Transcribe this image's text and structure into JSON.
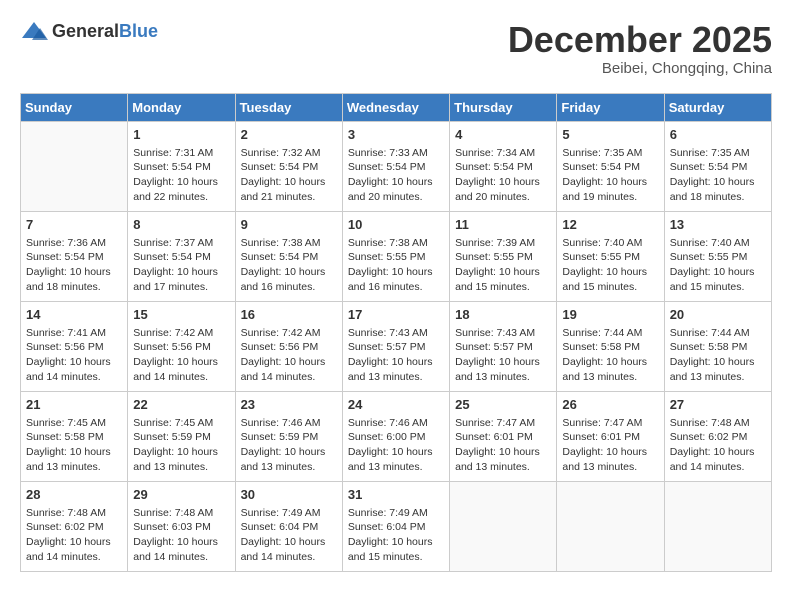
{
  "header": {
    "logo_general": "General",
    "logo_blue": "Blue",
    "month_title": "December 2025",
    "subtitle": "Beibei, Chongqing, China"
  },
  "days_of_week": [
    "Sunday",
    "Monday",
    "Tuesday",
    "Wednesday",
    "Thursday",
    "Friday",
    "Saturday"
  ],
  "weeks": [
    [
      {
        "day": "",
        "info": ""
      },
      {
        "day": "1",
        "info": "Sunrise: 7:31 AM\nSunset: 5:54 PM\nDaylight: 10 hours\nand 22 minutes."
      },
      {
        "day": "2",
        "info": "Sunrise: 7:32 AM\nSunset: 5:54 PM\nDaylight: 10 hours\nand 21 minutes."
      },
      {
        "day": "3",
        "info": "Sunrise: 7:33 AM\nSunset: 5:54 PM\nDaylight: 10 hours\nand 20 minutes."
      },
      {
        "day": "4",
        "info": "Sunrise: 7:34 AM\nSunset: 5:54 PM\nDaylight: 10 hours\nand 20 minutes."
      },
      {
        "day": "5",
        "info": "Sunrise: 7:35 AM\nSunset: 5:54 PM\nDaylight: 10 hours\nand 19 minutes."
      },
      {
        "day": "6",
        "info": "Sunrise: 7:35 AM\nSunset: 5:54 PM\nDaylight: 10 hours\nand 18 minutes."
      }
    ],
    [
      {
        "day": "7",
        "info": "Sunrise: 7:36 AM\nSunset: 5:54 PM\nDaylight: 10 hours\nand 18 minutes."
      },
      {
        "day": "8",
        "info": "Sunrise: 7:37 AM\nSunset: 5:54 PM\nDaylight: 10 hours\nand 17 minutes."
      },
      {
        "day": "9",
        "info": "Sunrise: 7:38 AM\nSunset: 5:54 PM\nDaylight: 10 hours\nand 16 minutes."
      },
      {
        "day": "10",
        "info": "Sunrise: 7:38 AM\nSunset: 5:55 PM\nDaylight: 10 hours\nand 16 minutes."
      },
      {
        "day": "11",
        "info": "Sunrise: 7:39 AM\nSunset: 5:55 PM\nDaylight: 10 hours\nand 15 minutes."
      },
      {
        "day": "12",
        "info": "Sunrise: 7:40 AM\nSunset: 5:55 PM\nDaylight: 10 hours\nand 15 minutes."
      },
      {
        "day": "13",
        "info": "Sunrise: 7:40 AM\nSunset: 5:55 PM\nDaylight: 10 hours\nand 15 minutes."
      }
    ],
    [
      {
        "day": "14",
        "info": "Sunrise: 7:41 AM\nSunset: 5:56 PM\nDaylight: 10 hours\nand 14 minutes."
      },
      {
        "day": "15",
        "info": "Sunrise: 7:42 AM\nSunset: 5:56 PM\nDaylight: 10 hours\nand 14 minutes."
      },
      {
        "day": "16",
        "info": "Sunrise: 7:42 AM\nSunset: 5:56 PM\nDaylight: 10 hours\nand 14 minutes."
      },
      {
        "day": "17",
        "info": "Sunrise: 7:43 AM\nSunset: 5:57 PM\nDaylight: 10 hours\nand 13 minutes."
      },
      {
        "day": "18",
        "info": "Sunrise: 7:43 AM\nSunset: 5:57 PM\nDaylight: 10 hours\nand 13 minutes."
      },
      {
        "day": "19",
        "info": "Sunrise: 7:44 AM\nSunset: 5:58 PM\nDaylight: 10 hours\nand 13 minutes."
      },
      {
        "day": "20",
        "info": "Sunrise: 7:44 AM\nSunset: 5:58 PM\nDaylight: 10 hours\nand 13 minutes."
      }
    ],
    [
      {
        "day": "21",
        "info": "Sunrise: 7:45 AM\nSunset: 5:58 PM\nDaylight: 10 hours\nand 13 minutes."
      },
      {
        "day": "22",
        "info": "Sunrise: 7:45 AM\nSunset: 5:59 PM\nDaylight: 10 hours\nand 13 minutes."
      },
      {
        "day": "23",
        "info": "Sunrise: 7:46 AM\nSunset: 5:59 PM\nDaylight: 10 hours\nand 13 minutes."
      },
      {
        "day": "24",
        "info": "Sunrise: 7:46 AM\nSunset: 6:00 PM\nDaylight: 10 hours\nand 13 minutes."
      },
      {
        "day": "25",
        "info": "Sunrise: 7:47 AM\nSunset: 6:01 PM\nDaylight: 10 hours\nand 13 minutes."
      },
      {
        "day": "26",
        "info": "Sunrise: 7:47 AM\nSunset: 6:01 PM\nDaylight: 10 hours\nand 13 minutes."
      },
      {
        "day": "27",
        "info": "Sunrise: 7:48 AM\nSunset: 6:02 PM\nDaylight: 10 hours\nand 14 minutes."
      }
    ],
    [
      {
        "day": "28",
        "info": "Sunrise: 7:48 AM\nSunset: 6:02 PM\nDaylight: 10 hours\nand 14 minutes."
      },
      {
        "day": "29",
        "info": "Sunrise: 7:48 AM\nSunset: 6:03 PM\nDaylight: 10 hours\nand 14 minutes."
      },
      {
        "day": "30",
        "info": "Sunrise: 7:49 AM\nSunset: 6:04 PM\nDaylight: 10 hours\nand 14 minutes."
      },
      {
        "day": "31",
        "info": "Sunrise: 7:49 AM\nSunset: 6:04 PM\nDaylight: 10 hours\nand 15 minutes."
      },
      {
        "day": "",
        "info": ""
      },
      {
        "day": "",
        "info": ""
      },
      {
        "day": "",
        "info": ""
      }
    ]
  ]
}
